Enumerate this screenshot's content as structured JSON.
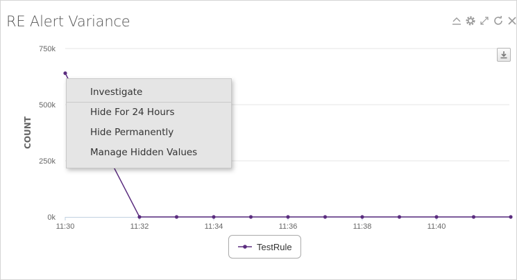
{
  "panel": {
    "title": "RE Alert Variance",
    "header_icons": [
      "collapse-icon",
      "gear-icon",
      "expand-icon",
      "refresh-icon",
      "close-icon"
    ]
  },
  "context_menu": {
    "items": [
      "Investigate",
      "Hide For 24 Hours",
      "Hide Permanently",
      "Manage Hidden Values"
    ]
  },
  "colors": {
    "series": "#5b2d7f",
    "gridline": "#e6e6e6",
    "menu_background": "#e5e5e5"
  },
  "chart_data": {
    "type": "line",
    "title": "",
    "xlabel": "",
    "ylabel": "COUNT",
    "x": [
      "11:30",
      "11:31",
      "11:32",
      "11:33",
      "11:34",
      "11:35",
      "11:36",
      "11:37",
      "11:38",
      "11:39",
      "11:40",
      "11:41",
      "11:42"
    ],
    "x_ticks": [
      "11:30",
      "11:32",
      "11:34",
      "11:36",
      "11:38",
      "11:40"
    ],
    "y_ticks": [
      "0k",
      "250k",
      "500k",
      "750k"
    ],
    "y_tick_values": [
      0,
      250000,
      500000,
      750000
    ],
    "ylim": [
      0,
      750000
    ],
    "grid": true,
    "legend_placement": "bottom",
    "series": [
      {
        "name": "TestRule",
        "color": "#5b2d7f",
        "values": [
          640000,
          320000,
          0,
          0,
          0,
          0,
          0,
          0,
          0,
          0,
          0,
          0,
          0
        ]
      }
    ]
  }
}
